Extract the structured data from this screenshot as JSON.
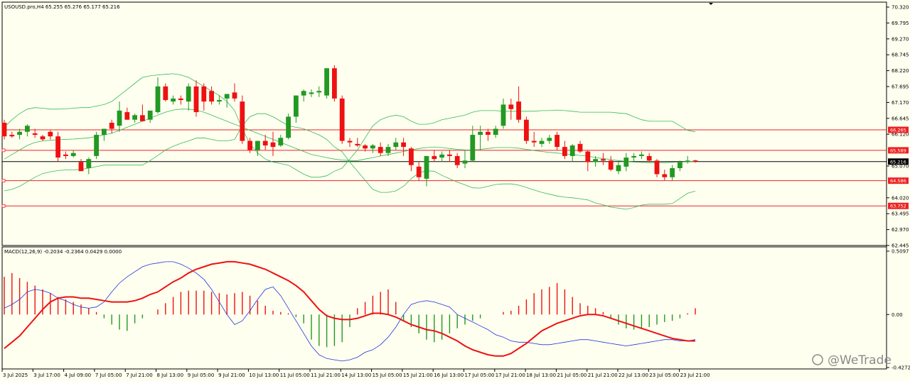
{
  "header": {
    "symbol_info": "USOUSD.pro,H4  65.255 65.276 65.177 65.216",
    "macd_info": "MACD(12,26,9) -0.2034 -0.2364 0.0429 0.0000"
  },
  "watermark": "@WeTrade",
  "colors": {
    "background": "#fffff0",
    "bull": "#229922",
    "bear": "#ee1111",
    "band": "#33bb55",
    "level": "#ee2222",
    "signal": "#ee1111",
    "macd_line": "#2233dd"
  },
  "price_axis": [
    "70.320",
    "69.795",
    "69.270",
    "68.745",
    "68.220",
    "67.695",
    "67.170",
    "66.645",
    "66.120",
    "65.070",
    "64.020",
    "63.495",
    "62.970",
    "62.445"
  ],
  "macd_axis": [
    "0.5097",
    "0.00",
    "-0.4272"
  ],
  "levels": [
    {
      "value": "66.265"
    },
    {
      "value": "65.589"
    },
    {
      "value": "64.586"
    },
    {
      "value": "63.752"
    }
  ],
  "current_price": "65.216",
  "time_labels": [
    "3 Jul 2025",
    "3 Jul 17:00",
    "4 Jul 09:00",
    "7 Jul 05:00",
    "7 Jul 21:00",
    "8 Jul 13:00",
    "9 Jul 05:00",
    "9 Jul 21:00",
    "10 Jul 13:00",
    "11 Jul 05:00",
    "11 Jul 21:00",
    "14 Jul 13:00",
    "15 Jul 05:00",
    "15 Jul 21:00",
    "16 Jul 13:00",
    "17 Jul 05:00",
    "17 Jul 21:00",
    "18 Jul 13:00",
    "21 Jul 05:00",
    "21 Jul 21:00",
    "22 Jul 13:00",
    "23 Jul 05:00",
    "23 Jul 21:00"
  ],
  "chart_data": {
    "type": "candlestick",
    "price_range": [
      62.445,
      70.32
    ],
    "macd_range": [
      -0.4272,
      0.5097
    ],
    "candles": [
      [
        66.5,
        66.6,
        65.95,
        66.05
      ],
      [
        66.1,
        66.2,
        66.0,
        66.05
      ],
      [
        66.1,
        66.3,
        65.95,
        66.2
      ],
      [
        66.2,
        66.45,
        66.05,
        66.4
      ],
      [
        66.15,
        66.3,
        66.0,
        66.1
      ],
      [
        66.05,
        66.1,
        65.9,
        65.95
      ],
      [
        66.2,
        66.25,
        65.95,
        66.05
      ],
      [
        66.05,
        66.2,
        65.2,
        65.35
      ],
      [
        65.45,
        65.55,
        65.3,
        65.4
      ],
      [
        65.4,
        65.6,
        65.35,
        65.5
      ],
      [
        65.2,
        65.3,
        65.0,
        64.9
      ],
      [
        65.0,
        65.35,
        64.8,
        65.3
      ],
      [
        65.4,
        66.2,
        65.3,
        66.1
      ],
      [
        66.1,
        66.25,
        65.9,
        66.3
      ],
      [
        66.5,
        66.6,
        66.15,
        66.3
      ],
      [
        66.4,
        67.2,
        66.2,
        66.9
      ],
      [
        66.85,
        67.0,
        66.6,
        66.6
      ],
      [
        66.6,
        66.8,
        66.5,
        66.75
      ],
      [
        66.75,
        67.1,
        66.55,
        66.55
      ],
      [
        66.6,
        66.9,
        66.5,
        66.9
      ],
      [
        66.85,
        68.0,
        66.8,
        67.7
      ],
      [
        67.7,
        67.8,
        67.2,
        67.25
      ],
      [
        67.2,
        67.4,
        67.1,
        67.3
      ],
      [
        67.3,
        67.4,
        67.1,
        67.25
      ],
      [
        67.2,
        67.8,
        66.9,
        67.7
      ],
      [
        67.7,
        67.9,
        66.7,
        66.85
      ],
      [
        67.7,
        67.8,
        66.9,
        67.2
      ],
      [
        67.55,
        67.7,
        67.1,
        67.2
      ],
      [
        67.2,
        67.4,
        67.1,
        67.25
      ],
      [
        67.3,
        67.45,
        67.0,
        67.45
      ],
      [
        67.5,
        67.8,
        67.2,
        67.3
      ],
      [
        67.2,
        67.4,
        65.8,
        65.9
      ],
      [
        65.9,
        66.0,
        65.5,
        65.6
      ],
      [
        65.6,
        65.9,
        65.4,
        65.9
      ],
      [
        65.9,
        66.1,
        65.6,
        65.75
      ],
      [
        65.85,
        66.2,
        65.4,
        65.7
      ],
      [
        65.75,
        66.1,
        65.7,
        66.0
      ],
      [
        66.0,
        66.8,
        65.95,
        66.7
      ],
      [
        66.7,
        67.4,
        66.5,
        67.4
      ],
      [
        67.4,
        67.6,
        67.2,
        67.55
      ],
      [
        67.45,
        67.6,
        67.35,
        67.5
      ],
      [
        67.5,
        67.7,
        67.35,
        67.55
      ],
      [
        67.4,
        68.3,
        67.3,
        68.3
      ],
      [
        68.3,
        68.4,
        67.2,
        67.3
      ],
      [
        67.3,
        67.4,
        65.8,
        65.9
      ],
      [
        65.9,
        66.0,
        65.7,
        65.85
      ],
      [
        65.8,
        66.0,
        65.7,
        65.75
      ],
      [
        65.75,
        65.8,
        65.55,
        65.65
      ],
      [
        65.65,
        65.8,
        65.5,
        65.75
      ],
      [
        65.7,
        65.85,
        65.4,
        65.5
      ],
      [
        65.5,
        65.8,
        65.4,
        65.7
      ],
      [
        65.7,
        66.0,
        65.6,
        65.85
      ],
      [
        65.85,
        66.0,
        65.4,
        65.7
      ],
      [
        65.65,
        65.7,
        64.9,
        65.1
      ],
      [
        65.05,
        65.2,
        64.6,
        64.7
      ],
      [
        64.65,
        65.4,
        64.4,
        65.4
      ],
      [
        65.4,
        65.6,
        65.2,
        65.3
      ],
      [
        65.35,
        65.55,
        65.2,
        65.45
      ],
      [
        65.45,
        65.6,
        65.2,
        65.4
      ],
      [
        65.4,
        65.5,
        65.0,
        65.1
      ],
      [
        65.15,
        65.6,
        65.0,
        65.25
      ],
      [
        65.25,
        66.4,
        65.2,
        66.1
      ],
      [
        66.1,
        66.4,
        65.6,
        66.2
      ],
      [
        66.2,
        66.3,
        65.9,
        66.1
      ],
      [
        66.1,
        66.4,
        66.0,
        66.3
      ],
      [
        66.4,
        67.3,
        66.3,
        67.1
      ],
      [
        67.1,
        67.3,
        66.6,
        66.95
      ],
      [
        67.2,
        67.7,
        66.5,
        66.6
      ],
      [
        66.6,
        66.7,
        65.8,
        65.9
      ],
      [
        65.9,
        66.2,
        65.7,
        65.85
      ],
      [
        65.8,
        66.0,
        65.7,
        65.9
      ],
      [
        65.9,
        66.1,
        65.8,
        66.0
      ],
      [
        66.1,
        66.2,
        65.6,
        65.7
      ],
      [
        65.7,
        65.9,
        65.3,
        65.4
      ],
      [
        65.4,
        65.8,
        65.2,
        65.75
      ],
      [
        65.8,
        65.9,
        65.5,
        65.55
      ],
      [
        65.55,
        65.6,
        64.9,
        65.2
      ],
      [
        65.2,
        65.4,
        65.05,
        65.3
      ],
      [
        65.3,
        65.5,
        65.1,
        65.25
      ],
      [
        65.25,
        65.4,
        64.9,
        64.95
      ],
      [
        64.9,
        65.2,
        64.8,
        65.1
      ],
      [
        65.05,
        65.5,
        64.9,
        65.35
      ],
      [
        65.35,
        65.5,
        65.2,
        65.4
      ],
      [
        65.4,
        65.55,
        65.3,
        65.45
      ],
      [
        65.4,
        65.5,
        65.2,
        65.25
      ],
      [
        65.25,
        65.3,
        64.7,
        64.8
      ],
      [
        64.8,
        64.95,
        64.6,
        64.7
      ],
      [
        64.7,
        65.1,
        64.6,
        65.0
      ],
      [
        65.0,
        65.25,
        64.9,
        65.2
      ],
      [
        65.2,
        65.4,
        65.15,
        65.25
      ],
      [
        65.255,
        65.276,
        65.177,
        65.216
      ]
    ],
    "bollinger": {
      "upper": [
        66.35,
        66.6,
        66.8,
        66.95,
        67.0,
        66.98,
        66.95,
        66.95,
        66.96,
        66.98,
        67.0,
        67.0,
        67.05,
        67.1,
        67.2,
        67.4,
        67.6,
        67.8,
        68.0,
        68.05,
        68.08,
        68.1,
        68.12,
        68.08,
        68.0,
        67.85,
        67.7,
        67.55,
        67.4,
        67.2,
        66.9,
        66.3,
        65.8,
        65.5,
        65.3,
        65.2,
        65.15,
        65.1,
        64.95,
        64.8,
        64.7,
        64.7,
        64.75,
        64.9,
        65.0,
        65.3,
        65.6,
        66.0,
        66.4,
        66.6,
        66.7,
        66.75,
        66.7,
        66.55,
        66.45,
        66.45,
        66.5,
        66.6,
        66.65,
        66.7,
        66.75,
        66.85,
        66.9,
        66.9,
        66.9,
        66.88,
        66.88,
        66.88,
        66.88,
        66.88,
        66.9,
        66.9,
        66.92,
        66.9,
        66.88,
        66.85,
        66.85,
        66.85,
        66.85,
        66.85,
        66.82,
        66.8,
        66.7,
        66.6,
        66.55,
        66.55,
        66.55,
        66.55,
        66.4,
        66.25,
        66.2
      ],
      "middle": [
        65.3,
        65.45,
        65.6,
        65.75,
        65.85,
        65.9,
        65.92,
        65.94,
        65.95,
        65.96,
        65.98,
        66.0,
        66.05,
        66.1,
        66.15,
        66.25,
        66.35,
        66.45,
        66.55,
        66.65,
        66.75,
        66.85,
        66.92,
        66.95,
        66.95,
        66.92,
        66.85,
        66.75,
        66.65,
        66.55,
        66.45,
        66.35,
        66.25,
        66.15,
        66.05,
        65.95,
        65.85,
        65.75,
        65.65,
        65.55,
        65.45,
        65.4,
        65.35,
        65.3,
        65.27,
        65.25,
        65.25,
        65.3,
        65.35,
        65.4,
        65.45,
        65.5,
        65.55,
        65.6,
        65.65,
        65.68,
        65.7,
        65.68,
        65.65,
        65.62,
        65.6,
        65.6,
        65.62,
        65.65,
        65.68,
        65.68,
        65.68,
        65.66,
        65.62,
        65.58,
        65.55,
        65.52,
        65.5,
        65.47,
        65.45,
        65.42,
        65.4,
        65.35,
        65.32,
        65.28,
        65.25,
        65.22,
        65.2,
        65.19,
        65.18,
        65.18,
        65.18,
        65.19,
        65.2,
        65.21,
        65.22
      ],
      "lower": [
        64.25,
        64.3,
        64.4,
        64.55,
        64.7,
        64.82,
        64.88,
        64.92,
        64.94,
        64.94,
        64.96,
        65.0,
        65.05,
        65.1,
        65.1,
        65.1,
        65.1,
        65.1,
        65.1,
        65.25,
        65.42,
        65.6,
        65.72,
        65.82,
        65.9,
        65.99,
        66.0,
        65.95,
        65.9,
        65.9,
        65.95,
        66.4,
        66.7,
        66.8,
        66.8,
        66.7,
        66.55,
        66.4,
        66.35,
        66.3,
        66.2,
        66.1,
        65.95,
        65.7,
        65.54,
        65.2,
        64.9,
        64.6,
        64.3,
        64.2,
        64.2,
        64.25,
        64.4,
        64.65,
        64.85,
        64.91,
        64.9,
        64.76,
        64.65,
        64.54,
        64.45,
        64.35,
        64.34,
        64.4,
        64.46,
        64.48,
        64.48,
        64.44,
        64.36,
        64.28,
        64.2,
        64.14,
        64.08,
        64.04,
        64.02,
        63.99,
        63.95,
        63.85,
        63.79,
        63.71,
        63.68,
        63.64,
        63.7,
        63.78,
        63.81,
        63.81,
        63.81,
        63.83,
        64.0,
        64.17,
        64.24
      ]
    },
    "macd": {
      "histogram": [
        0.3,
        0.33,
        0.29,
        0.26,
        0.23,
        0.2,
        0.17,
        0.14,
        0.12,
        0.1,
        0.08,
        0.05,
        0.02,
        -0.03,
        -0.08,
        -0.12,
        -0.13,
        -0.07,
        -0.03,
        0.0,
        0.04,
        0.09,
        0.14,
        0.18,
        0.19,
        0.19,
        0.19,
        0.18,
        0.17,
        0.16,
        0.17,
        0.18,
        0.15,
        0.11,
        0.07,
        0.03,
        0.02,
        0.01,
        -0.02,
        -0.07,
        -0.2,
        -0.25,
        -0.26,
        -0.25,
        -0.22,
        -0.1,
        0.05,
        0.1,
        0.15,
        0.18,
        0.2,
        0.1,
        -0.05,
        -0.1,
        -0.15,
        -0.2,
        -0.22,
        -0.2,
        -0.15,
        -0.11,
        -0.08,
        -0.05,
        -0.03,
        0.0,
        0.0,
        0.02,
        0.03,
        0.07,
        0.12,
        0.17,
        0.2,
        0.22,
        0.25,
        0.2,
        0.14,
        0.09,
        0.07,
        0.05,
        0.02,
        -0.03,
        -0.08,
        -0.11,
        -0.12,
        -0.11,
        -0.1,
        -0.08,
        -0.06,
        -0.05,
        -0.03,
        0.01,
        0.05
      ],
      "macd_line": [
        0.05,
        0.08,
        0.12,
        0.18,
        0.2,
        0.19,
        0.17,
        0.13,
        0.11,
        0.08,
        0.06,
        0.05,
        0.06,
        0.1,
        0.18,
        0.25,
        0.3,
        0.34,
        0.38,
        0.4,
        0.41,
        0.42,
        0.42,
        0.4,
        0.37,
        0.33,
        0.28,
        0.2,
        0.1,
        0.0,
        -0.08,
        -0.05,
        0.03,
        0.12,
        0.2,
        0.22,
        0.15,
        0.05,
        -0.05,
        -0.15,
        -0.25,
        -0.32,
        -0.35,
        -0.36,
        -0.37,
        -0.36,
        -0.34,
        -0.3,
        -0.28,
        -0.24,
        -0.18,
        -0.1,
        0.0,
        0.08,
        0.1,
        0.11,
        0.1,
        0.08,
        0.06,
        0.0,
        -0.03,
        -0.06,
        -0.09,
        -0.12,
        -0.16,
        -0.18,
        -0.21,
        -0.22,
        -0.22,
        -0.23,
        -0.24,
        -0.24,
        -0.23,
        -0.22,
        -0.21,
        -0.2,
        -0.2,
        -0.21,
        -0.22,
        -0.23,
        -0.24,
        -0.25,
        -0.24,
        -0.23,
        -0.22,
        -0.21,
        -0.2,
        -0.2,
        -0.21,
        -0.21,
        -0.2
      ],
      "signal_line": [
        -0.27,
        -0.22,
        -0.17,
        -0.1,
        -0.03,
        0.04,
        0.1,
        0.13,
        0.14,
        0.14,
        0.13,
        0.13,
        0.12,
        0.11,
        0.1,
        0.1,
        0.1,
        0.11,
        0.13,
        0.16,
        0.18,
        0.22,
        0.26,
        0.29,
        0.33,
        0.36,
        0.38,
        0.4,
        0.41,
        0.42,
        0.42,
        0.41,
        0.4,
        0.38,
        0.36,
        0.33,
        0.3,
        0.27,
        0.23,
        0.18,
        0.11,
        0.04,
        -0.01,
        -0.03,
        -0.04,
        -0.04,
        -0.03,
        -0.01,
        0.01,
        0.01,
        0.0,
        -0.02,
        -0.05,
        -0.08,
        -0.1,
        -0.12,
        -0.13,
        -0.15,
        -0.18,
        -0.21,
        -0.25,
        -0.28,
        -0.3,
        -0.32,
        -0.33,
        -0.33,
        -0.31,
        -0.27,
        -0.23,
        -0.18,
        -0.13,
        -0.1,
        -0.07,
        -0.05,
        -0.03,
        -0.01,
        0.0,
        0.0,
        -0.01,
        -0.03,
        -0.05,
        -0.07,
        -0.09,
        -0.11,
        -0.13,
        -0.15,
        -0.17,
        -0.19,
        -0.2,
        -0.21,
        -0.21
      ]
    }
  }
}
